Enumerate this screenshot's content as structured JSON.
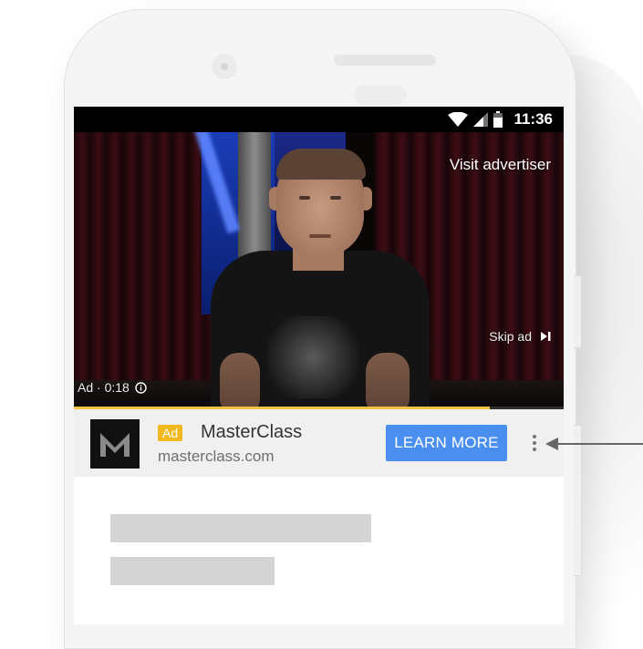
{
  "status_bar": {
    "time": "11:36",
    "icons": [
      "wifi-icon",
      "signal-icon",
      "battery-icon"
    ]
  },
  "video": {
    "visit_advertiser": "Visit advertiser",
    "skip_ad": "Skip ad",
    "ad_timer": "Ad · 0:18",
    "progress_fraction": 0.85
  },
  "ad_bar": {
    "logo_letter": "M",
    "badge": "Ad",
    "advertiser_name": "MasterClass",
    "advertiser_url": "masterclass.com",
    "cta_label": "LEARN MORE",
    "menu_icon": "more-vert-icon"
  },
  "colors": {
    "badge": "#f2b91e",
    "cta": "#4a8ff0",
    "progress": "#f3c341",
    "ad_bar_bg": "#f0f0f0",
    "skeleton": "#d4d4d4"
  }
}
